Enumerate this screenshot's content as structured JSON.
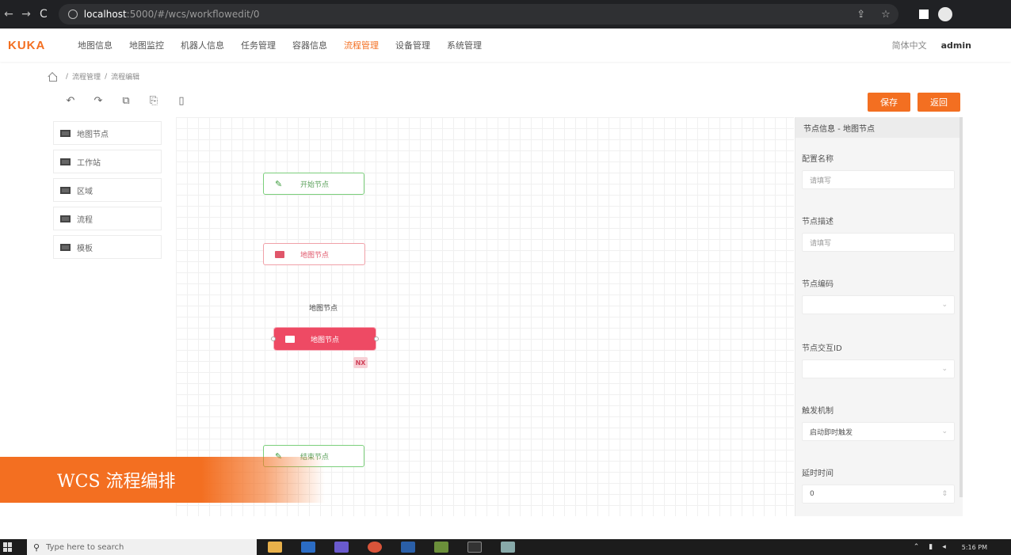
{
  "browser": {
    "url_host": "localhost",
    "url_path": ":5000/#/wcs/workflowedit/0"
  },
  "header": {
    "logo": "KUKA",
    "menu": [
      {
        "label": "地图信息",
        "active": false
      },
      {
        "label": "地图监控",
        "active": false
      },
      {
        "label": "机器人信息",
        "active": false
      },
      {
        "label": "任务管理",
        "active": false
      },
      {
        "label": "容器信息",
        "active": false
      },
      {
        "label": "流程管理",
        "active": true
      },
      {
        "label": "设备管理",
        "active": false
      },
      {
        "label": "系统管理",
        "active": false
      }
    ],
    "language": "简体中文",
    "user": "admin"
  },
  "breadcrumb": [
    "流程管理",
    "流程编辑"
  ],
  "buttons": {
    "save": "保存",
    "back": "返回"
  },
  "palette": [
    "地图节点",
    "工作站",
    "区域",
    "流程",
    "模板"
  ],
  "canvas": {
    "start_node": "开始节点",
    "map_node": "地图节点",
    "floating_label": "地图节点",
    "selected_node": "地图节点",
    "nx_badge": "NX",
    "end_node": "结束节点"
  },
  "panel": {
    "title": "节点信息 - 地图节点",
    "fields": [
      {
        "label": "配置名称",
        "placeholder": "请填写",
        "value": ""
      },
      {
        "label": "节点描述",
        "placeholder": "请填写",
        "value": ""
      },
      {
        "label": "节点编码",
        "placeholder": "",
        "value": ""
      },
      {
        "label": "节点交互ID",
        "placeholder": "",
        "value": ""
      },
      {
        "label": "触发机制",
        "placeholder": "",
        "value": "启动即时触发"
      },
      {
        "label": "延时时间",
        "placeholder": "",
        "value": "0"
      }
    ]
  },
  "banner": "WCS 流程编排",
  "taskbar": {
    "search_placeholder": "Type here to search",
    "clock": "5:16 PM"
  }
}
